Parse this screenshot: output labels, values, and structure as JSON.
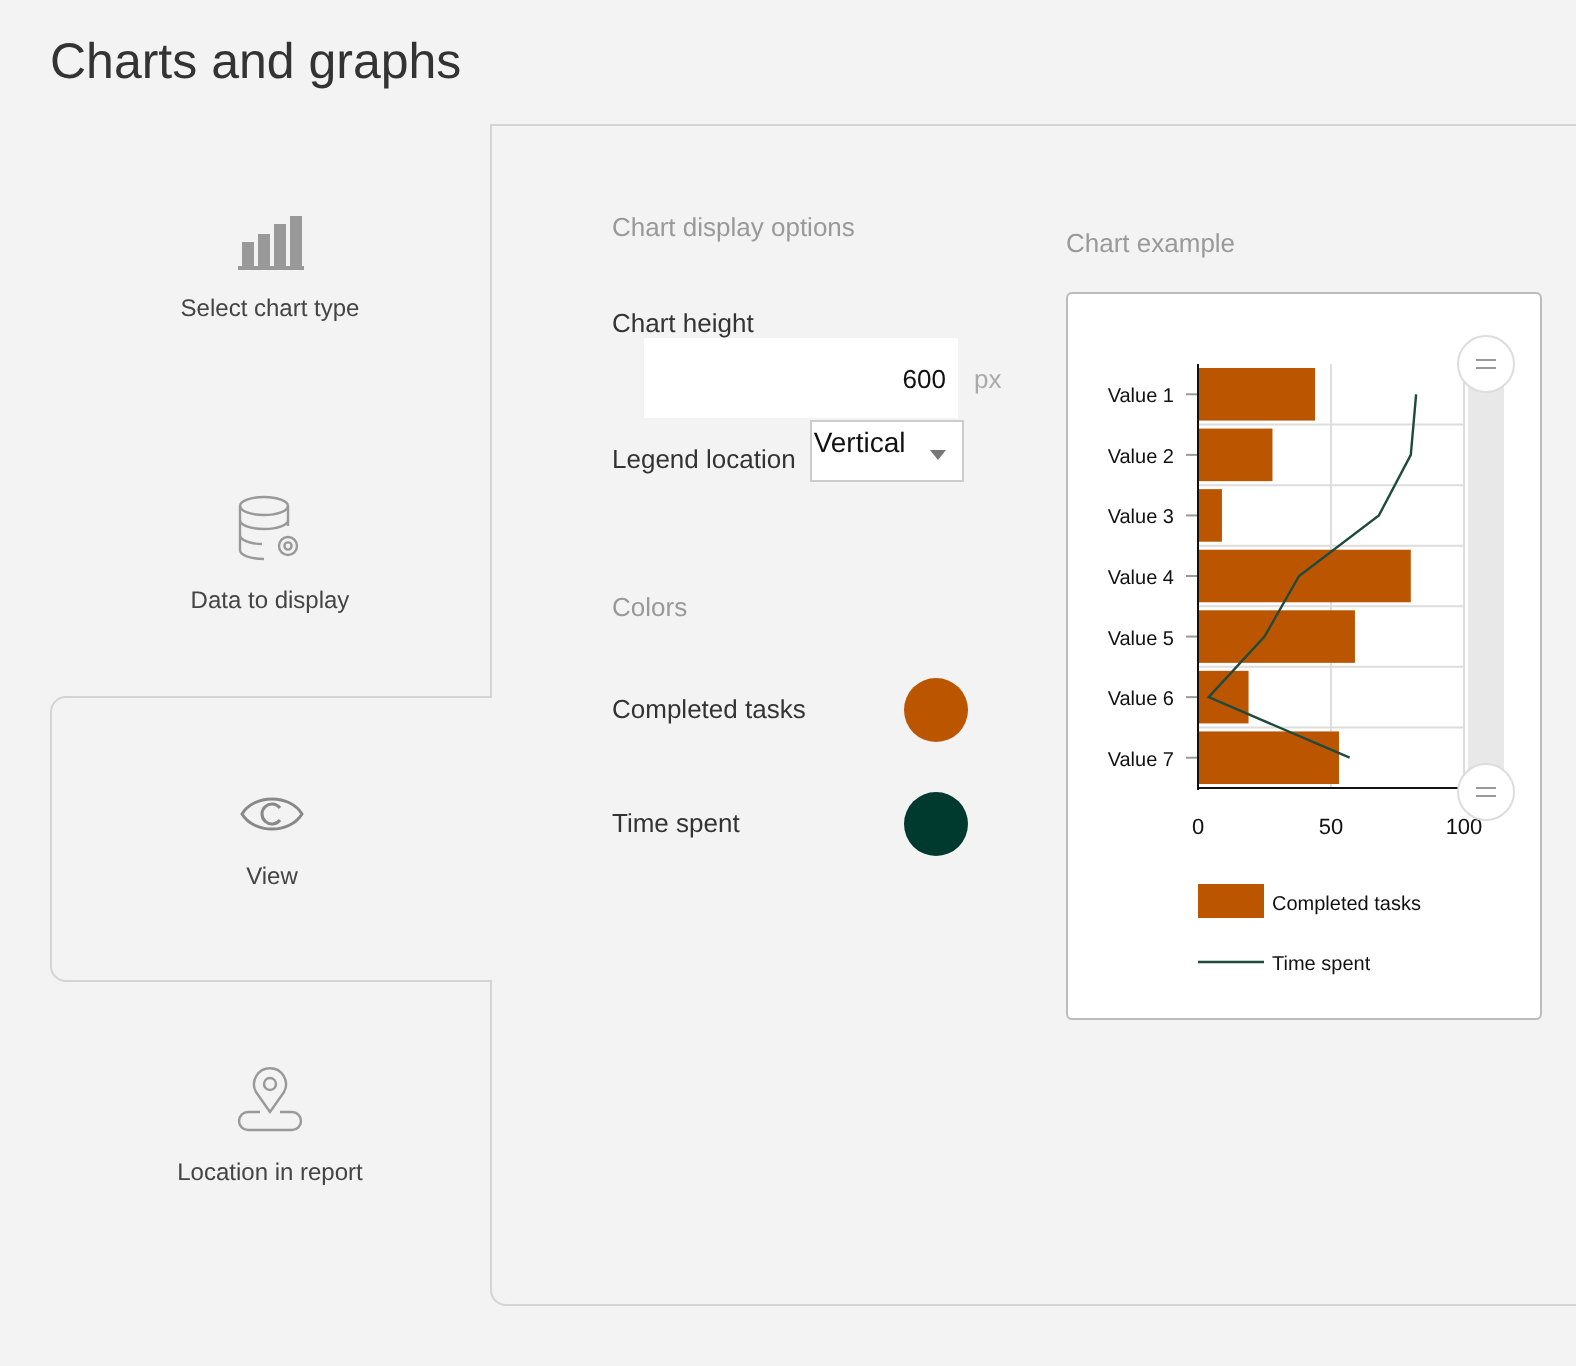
{
  "page": {
    "title": "Charts and graphs"
  },
  "nav": [
    {
      "label": "Select chart type",
      "selected": false
    },
    {
      "label": "Data to display",
      "selected": false
    },
    {
      "label": "View",
      "selected": true
    },
    {
      "label": "Location in report",
      "selected": false
    }
  ],
  "options": {
    "heading": "Chart display options",
    "chart_height": {
      "label": "Chart height",
      "value": "600",
      "unit": "px"
    },
    "legend_location": {
      "label": "Legend location",
      "value": "Vertical"
    }
  },
  "colors": {
    "heading": "Colors",
    "items": [
      {
        "label": "Completed tasks",
        "color": "#bb5500"
      },
      {
        "label": "Time spent",
        "color": "#003a2f"
      }
    ]
  },
  "example": {
    "heading": "Chart example",
    "chart_data": {
      "type": "bar",
      "orientation": "horizontal",
      "categories": [
        "Value 1",
        "Value 2",
        "Value 3",
        "Value 4",
        "Value 5",
        "Value 6",
        "Value 7"
      ],
      "xlim": [
        0,
        100
      ],
      "xticks": [
        0,
        50,
        100
      ],
      "legend": "bottom",
      "grid": true,
      "series": [
        {
          "name": "Completed tasks",
          "type": "bar",
          "color": "#bb5500",
          "values": [
            44,
            28,
            9,
            80,
            59,
            19,
            53
          ]
        },
        {
          "name": "Time spent",
          "type": "line",
          "color": "#1f4a3e",
          "values": [
            82,
            80,
            68,
            38,
            25,
            4,
            57
          ]
        }
      ]
    }
  }
}
